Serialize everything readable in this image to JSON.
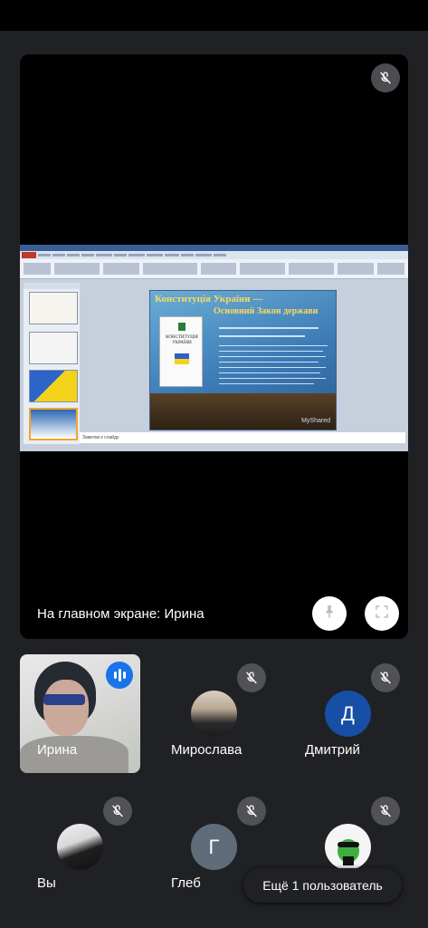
{
  "main_stage": {
    "label": "На главном экране: Ирина",
    "presentation": {
      "slide_title": "Конституція України —",
      "slide_subtitle": "Основний Закон держави",
      "book_text": "КОНСТИТУЦІЯ УКРАЇНИ",
      "watermark": "MyShared",
      "notes_placeholder": "Заметки к слайду"
    }
  },
  "participants": [
    {
      "name": "Ирина",
      "speaking": true
    },
    {
      "name": "Мирослава",
      "muted": true
    },
    {
      "name": "Дмитрий",
      "initial": "Д",
      "avatar_color": "#174ea6",
      "muted": true
    },
    {
      "name": "Вы",
      "muted": true
    },
    {
      "name": "Глеб",
      "initial": "Г",
      "avatar_color": "#5f6d7a",
      "muted": true
    }
  ],
  "more_users": "Ещё 1 пользователь",
  "colors": {
    "background": "#202124",
    "speaking_accent": "#1a73e8"
  },
  "icons": [
    "mic-off-icon",
    "pin-icon",
    "fit-screen-icon",
    "audio-wave-icon"
  ]
}
